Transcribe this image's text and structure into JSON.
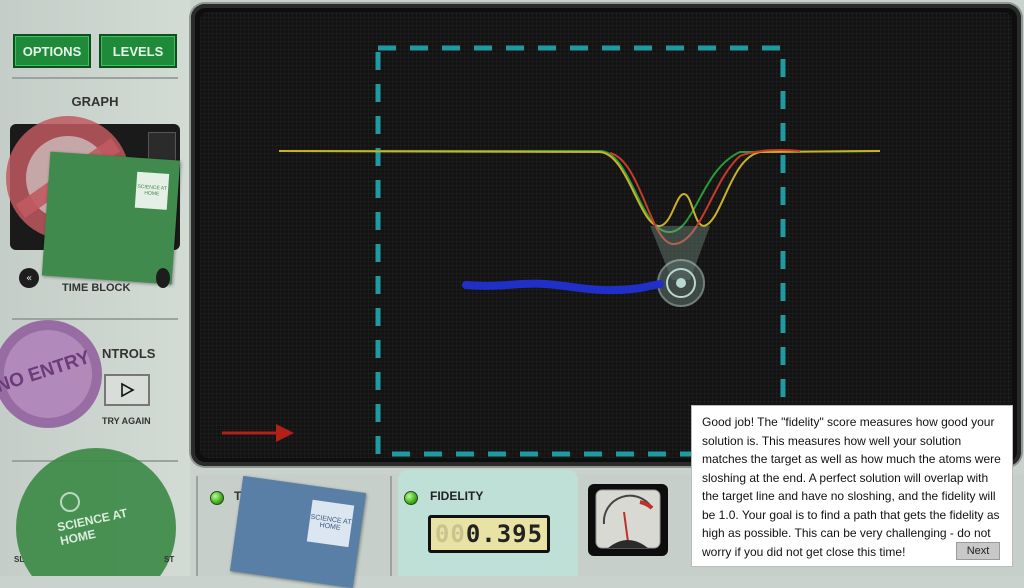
{
  "toolbar": {
    "options_label": "OPTIONS",
    "levels_label": "LEVELS"
  },
  "left_panel": {
    "graph_title": "GRAPH",
    "time_block_label": "TIME BLOCK",
    "controls_title": "NTROLS",
    "try_again_label": "TRY AGAIN",
    "bottom_left_label": "SL",
    "bottom_right_label": "ST"
  },
  "stickers": {
    "science_at_home": "SCIENCE AT HOME",
    "no_entry": "NO ENTRY",
    "science_small": "SCIENCE AT HOME"
  },
  "bottom_panel": {
    "time_label_fragment": "TI",
    "fidelity_label": "FIDELITY",
    "fidelity_value_dim": "00",
    "fidelity_value": "0.395"
  },
  "dialog": {
    "text": "Good job! The \"fidelity\" score measures how good your solution is. This measures how well your solution matches the target as well as how much the atoms were sloshing at the end. A perfect solution will overlap with the target line and have no sloshing, and the fidelity will be 1.0. Your goal is to find a path that gets the fidelity as high as possible.  This can be very challenging - do not worry if you did not get close this time!",
    "next_label": "Next"
  },
  "colors": {
    "button_green": "#1f8a3a",
    "target_line": "#2a9a3a",
    "potential_line": "#c9b12a",
    "atom_line": "#c83a2a",
    "path_blue": "#1f2fc8",
    "dashed_box": "#1f9aa0",
    "arrow_red": "#b3201a"
  }
}
